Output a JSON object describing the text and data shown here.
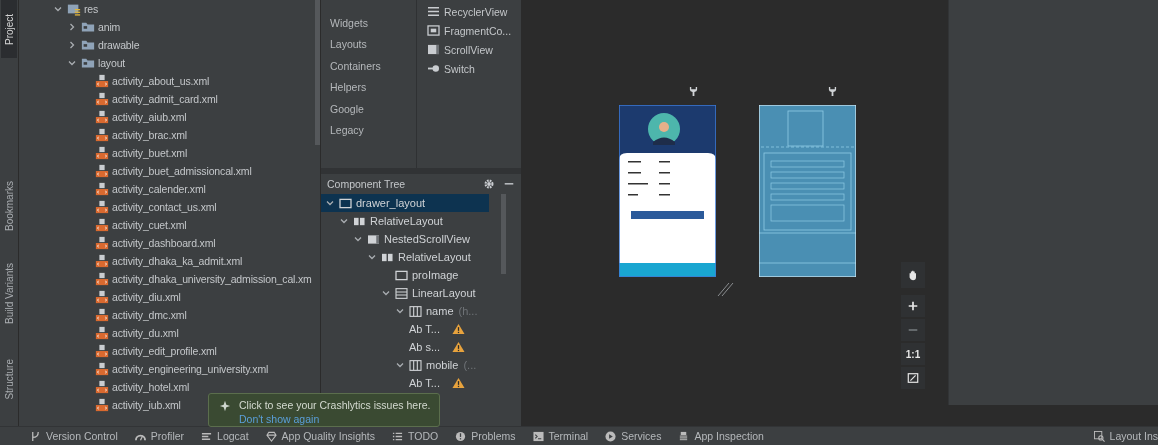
{
  "side_strip": [
    {
      "label": "Project",
      "selected": true
    },
    {
      "label": "Bookmarks",
      "selected": false
    },
    {
      "label": "Build Variants",
      "selected": false
    },
    {
      "label": "Structure",
      "selected": false
    }
  ],
  "project_tree": [
    {
      "label": "res",
      "kind": "res",
      "expanded": true,
      "children": [
        {
          "label": "anim",
          "kind": "folder",
          "expanded": false
        },
        {
          "label": "drawable",
          "kind": "folder",
          "expanded": false
        },
        {
          "label": "layout",
          "kind": "folder",
          "expanded": true,
          "children": [
            {
              "label": "activity_about_us.xml",
              "kind": "xml"
            },
            {
              "label": "activity_admit_card.xml",
              "kind": "xml"
            },
            {
              "label": "activity_aiub.xml",
              "kind": "xml"
            },
            {
              "label": "activity_brac.xml",
              "kind": "xml"
            },
            {
              "label": "activity_buet.xml",
              "kind": "xml"
            },
            {
              "label": "activity_buet_admissioncal.xml",
              "kind": "xml"
            },
            {
              "label": "activity_calender.xml",
              "kind": "xml"
            },
            {
              "label": "activity_contact_us.xml",
              "kind": "xml"
            },
            {
              "label": "activity_cuet.xml",
              "kind": "xml"
            },
            {
              "label": "activity_dashboard.xml",
              "kind": "xml"
            },
            {
              "label": "activity_dhaka_ka_admit.xml",
              "kind": "xml"
            },
            {
              "label": "activity_dhaka_university_admission_cal.xm",
              "kind": "xml"
            },
            {
              "label": "activity_diu.xml",
              "kind": "xml"
            },
            {
              "label": "activity_dmc.xml",
              "kind": "xml"
            },
            {
              "label": "activity_du.xml",
              "kind": "xml"
            },
            {
              "label": "activity_edit_profile.xml",
              "kind": "xml"
            },
            {
              "label": "activity_engineering_university.xml",
              "kind": "xml"
            },
            {
              "label": "activity_hotel.xml",
              "kind": "xml"
            },
            {
              "label": "activity_iub.xml",
              "kind": "xml"
            }
          ]
        }
      ]
    }
  ],
  "palette": {
    "categories": [
      {
        "label": "Widgets",
        "selected": false
      },
      {
        "label": "Layouts",
        "selected": false
      },
      {
        "label": "Containers",
        "selected": false
      },
      {
        "label": "Helpers",
        "selected": false
      },
      {
        "label": "Google",
        "selected": false
      },
      {
        "label": "Legacy",
        "selected": false
      }
    ],
    "items": [
      {
        "label": "RecyclerView",
        "kind": "list"
      },
      {
        "label": "FragmentCo...",
        "kind": "fragment"
      },
      {
        "label": "ScrollView",
        "kind": "scroll"
      },
      {
        "label": "Switch",
        "kind": "switch"
      }
    ]
  },
  "component_tree": {
    "title": "Component Tree",
    "items": [
      {
        "label": "drawer_layout",
        "kind": "frame",
        "selected": true,
        "expanded": true,
        "children": [
          {
            "label": "RelativeLayout",
            "kind": "relative",
            "selected": false,
            "expanded": true,
            "children": [
              {
                "label": "NestedScrollView",
                "kind": "scroll",
                "selected": false,
                "expanded": true,
                "children": [
                  {
                    "label": "RelativeLayout",
                    "kind": "relative",
                    "selected": false,
                    "expanded": true,
                    "children": [
                      {
                        "label": "proImage",
                        "kind": "frame",
                        "selected": false
                      },
                      {
                        "label": "LinearLayout",
                        "kind": "linear",
                        "selected": false,
                        "expanded": true,
                        "children": [
                          {
                            "label": "name",
                            "hint": "(h...",
                            "kind": "columns",
                            "selected": false,
                            "expanded": true,
                            "children": [
                              {
                                "label": "Ab T...",
                                "kind": "text",
                                "selected": false,
                                "warning": true
                              },
                              {
                                "label": "Ab s...",
                                "kind": "text",
                                "selected": false,
                                "warning": true
                              }
                            ]
                          },
                          {
                            "label": "mobile",
                            "hint": "(...",
                            "kind": "columns",
                            "selected": false,
                            "expanded": true,
                            "children": [
                              {
                                "label": "Ab T...",
                                "kind": "text",
                                "selected": false,
                                "warning": true
                              }
                            ]
                          }
                        ]
                      }
                    ]
                  }
                ]
              }
            ]
          }
        ]
      }
    ]
  },
  "zoom_controls": [
    {
      "kind": "pan"
    },
    {
      "kind": "zoom-in"
    },
    {
      "kind": "zoom-out"
    },
    {
      "kind": "actual",
      "label": "1:1"
    },
    {
      "kind": "fit"
    }
  ],
  "tooltip": {
    "message": "Click to see your Crashlytics issues here.",
    "link": "Don't show again"
  },
  "tool_windows": [
    {
      "label": "Version Control",
      "kind": "vcs"
    },
    {
      "label": "Profiler",
      "kind": "profiler"
    },
    {
      "label": "Logcat",
      "kind": "logcat"
    },
    {
      "label": "App Quality Insights",
      "kind": "aqi"
    },
    {
      "label": "TODO",
      "kind": "todo"
    },
    {
      "label": "Problems",
      "kind": "problems"
    },
    {
      "label": "Terminal",
      "kind": "terminal"
    },
    {
      "label": "Services",
      "kind": "services"
    },
    {
      "label": "App Inspection",
      "kind": "inspection"
    }
  ],
  "right_tool_window": {
    "label": "Layout Ins",
    "kind": "layout-inspector"
  }
}
